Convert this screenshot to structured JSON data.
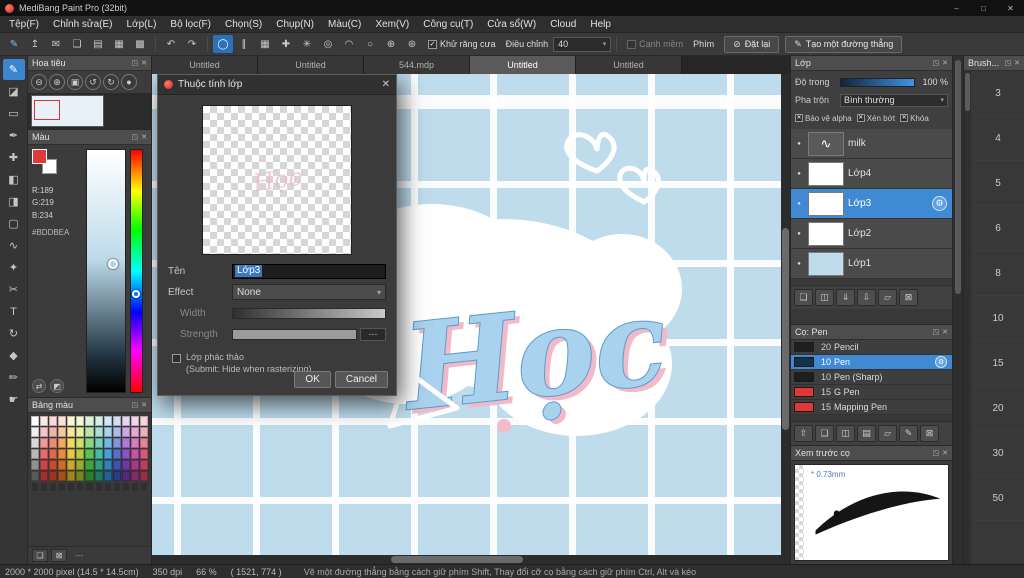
{
  "ui": {
    "float_icon": "◳",
    "close_icon": "✕",
    "dropdown_arrow": "▾",
    "gear_icon": "⚙",
    "eye_icon": "●",
    "check_icon": "✓",
    "x_mark": "✕",
    "stroke_glyph": "∿"
  },
  "colors": {
    "accent_blue": "#3c86d1",
    "selection_blue": "#3f8ad2",
    "canvas_background": "#bedcec",
    "panel_dark": "#3c3c3c"
  },
  "titlebar": {
    "title": "MediBang Paint Pro (32bit)",
    "minimize_icon": "–",
    "maximize_icon": "□",
    "close_icon": "✕"
  },
  "menubar": {
    "items": [
      "Tệp(F)",
      "Chỉnh sửa(E)",
      "Lớp(L)",
      "Bộ lọc(F)",
      "Chọn(S)",
      "Chụp(N)",
      "Màu(C)",
      "Xem(V)",
      "Công cụ(T)",
      "Cửa sổ(W)",
      "Cloud",
      "Help"
    ]
  },
  "toolbar": {
    "file_icons": [
      {
        "name": "brush-edit-icon",
        "glyph": "✎",
        "accent": true
      },
      {
        "name": "publish-icon",
        "glyph": "↥"
      },
      {
        "name": "message-icon",
        "glyph": "✉"
      },
      {
        "name": "export-icon",
        "glyph": "❏"
      },
      {
        "name": "save-icon",
        "glyph": "▤"
      },
      {
        "name": "grid-small-icon",
        "glyph": "▦"
      },
      {
        "name": "grid-large-icon",
        "glyph": "▩"
      }
    ],
    "history_icons": [
      {
        "name": "undo-icon",
        "glyph": "↶"
      },
      {
        "name": "redo-icon",
        "glyph": "↷"
      }
    ],
    "snap_icons": [
      {
        "name": "snap-off-icon",
        "glyph": "◯",
        "selected": true
      },
      {
        "name": "snap-parallel-icon",
        "glyph": "∥"
      },
      {
        "name": "snap-grid-icon",
        "glyph": "▦"
      },
      {
        "name": "snap-cross-icon",
        "glyph": "✚"
      },
      {
        "name": "snap-radial-icon",
        "glyph": "✳"
      },
      {
        "name": "snap-concentric-icon",
        "glyph": "◎"
      },
      {
        "name": "snap-curve-icon",
        "glyph": "◠"
      },
      {
        "name": "snap-ellipse-icon",
        "glyph": "○"
      },
      {
        "name": "snap-add-icon",
        "glyph": "⊕"
      },
      {
        "name": "snap-settings-icon",
        "glyph": "⊛"
      }
    ],
    "antialias_label": "Khử răng cưa",
    "adjust_label": "Điều chỉnh",
    "adjust_value": "40",
    "soft_edge_label": "Cạnh mềm",
    "key_label": "Phím",
    "reset_icon": "⊘",
    "reset_button": "Đặt lại",
    "line_icon": "✎",
    "line_button": "Tạo một đường thẳng"
  },
  "tools": [
    {
      "name": "brush-tool",
      "glyph": "✎",
      "selected": true
    },
    {
      "name": "eraser-tool",
      "glyph": "◪"
    },
    {
      "name": "shape-brush-tool",
      "glyph": "▭"
    },
    {
      "name": "dot-pen-tool",
      "glyph": "✒"
    },
    {
      "name": "move-tool",
      "glyph": "✚"
    },
    {
      "name": "fill-tool",
      "glyph": "◧"
    },
    {
      "name": "gradient-tool",
      "glyph": "◨"
    },
    {
      "name": "select-tool",
      "glyph": "▢"
    },
    {
      "name": "lasso-tool",
      "glyph": "∿"
    },
    {
      "name": "magic-wand-tool",
      "glyph": "✦"
    },
    {
      "name": "select-pen-tool",
      "glyph": "✂"
    },
    {
      "name": "text-tool",
      "glyph": "T"
    },
    {
      "name": "rotate-tool",
      "glyph": "↻"
    },
    {
      "name": "eyedropper-tool",
      "glyph": "◆"
    },
    {
      "name": "pencil-tool",
      "glyph": "✏"
    },
    {
      "name": "hand-tool",
      "glyph": "☛"
    }
  ],
  "left": {
    "navigator": {
      "title": "Hoa tiêu",
      "buttons": [
        {
          "name": "zoom-out-icon",
          "glyph": "⊖"
        },
        {
          "name": "zoom-in-icon",
          "glyph": "⊕"
        },
        {
          "name": "fit-view-icon",
          "glyph": "▣"
        },
        {
          "name": "rotate-left-icon",
          "glyph": "↺"
        },
        {
          "name": "rotate-right-icon",
          "glyph": "↻"
        },
        {
          "name": "reset-view-icon",
          "glyph": "●"
        }
      ]
    },
    "color": {
      "title": "Màu",
      "r": "R:189",
      "g": "G:219",
      "b": "B:234",
      "hex": "#BDDBEA",
      "foreground": "#e03a3a",
      "background_swatch": "#ffffff",
      "icons": [
        {
          "name": "swap-colors-icon",
          "glyph": "⇄"
        },
        {
          "name": "add-to-palette-icon",
          "glyph": "◩"
        }
      ]
    },
    "palette": {
      "title": "Bảng màu",
      "add_icon": "❏",
      "delete_icon": "⊠",
      "footer_value": "---",
      "colors": [
        [
          "#ffffff",
          "#fce9e9",
          "#fbd9d9",
          "#fbe4d4",
          "#fdf3d7",
          "#f4f7d4",
          "#ddf2d6",
          "#d2f0e8",
          "#d2e8f6",
          "#d6dcf4",
          "#e6d6f2",
          "#f4d6ea",
          "#f6d6da"
        ],
        [
          "#f0f0f0",
          "#f6c6c6",
          "#f3b3ac",
          "#f6ca9e",
          "#f8e79d",
          "#e6efa3",
          "#bce6b0",
          "#a9e0d2",
          "#a8d4ee",
          "#aebae8",
          "#cbaae4",
          "#e8aad4",
          "#eeb0bb"
        ],
        [
          "#d8d8d8",
          "#ee9a9a",
          "#ec8a77",
          "#f0a969",
          "#f4d867",
          "#cfe070",
          "#8cd584",
          "#74ceba",
          "#74b9e4",
          "#8393dc",
          "#ac7cd4",
          "#da7cbc",
          "#e4839a"
        ],
        [
          "#b8b8b8",
          "#e36c6c",
          "#e2664a",
          "#e88b3d",
          "#ecc63c",
          "#b4cc44",
          "#5cc258",
          "#44bda0",
          "#4a9ed8",
          "#5a70cc",
          "#8c54c0",
          "#c854a4",
          "#d65a7e"
        ],
        [
          "#909090",
          "#c84848",
          "#c44a30",
          "#ca6e28",
          "#cea828",
          "#94ac30",
          "#3ea43c",
          "#2e9d82",
          "#347fba",
          "#3e52ae",
          "#6e3aa2",
          "#a63a86",
          "#b84062"
        ],
        [
          "#5a5a5a",
          "#9e3232",
          "#9a3620",
          "#a0541c",
          "#a4841c",
          "#748822",
          "#2a8028",
          "#1f7a64",
          "#246294",
          "#2a3a8c",
          "#522a80",
          "#842a68",
          "#92304a"
        ],
        [
          "",
          "",
          "",
          "",
          "",
          "",
          "",
          "",
          "",
          "",
          "",
          "",
          ""
        ]
      ]
    }
  },
  "canvas": {
    "tabs": [
      {
        "label": "Untitled"
      },
      {
        "label": "Untitled"
      },
      {
        "label": "544.mdp"
      },
      {
        "label": "Untitled",
        "selected": true
      },
      {
        "label": "Untitled"
      }
    ],
    "artwork_text": "Học",
    "background_color": "#bedcec"
  },
  "dialog": {
    "title": "Thuộc tính lớp",
    "close_icon": "✕",
    "name_label": "Tên",
    "name_value": "Lớp3",
    "effect_label": "Effect",
    "effect_value": "None",
    "width_label": "Width",
    "strength_label": "Strength",
    "strength_value": "---",
    "draft_line1": "Lớp phác thảo",
    "draft_line2": "(Submit: Hide when rasterizing)",
    "ok_button": "OK",
    "cancel_button": "Cancel"
  },
  "right": {
    "layers": {
      "title": "Lớp",
      "opacity_label": "Độ trong",
      "opacity_value": "100 %",
      "blend_label": "Pha trộn",
      "blend_value": "Bình thường",
      "alpha_label": "Bảo vệ alpha",
      "clip_label": "Xén bớt",
      "lock_label": "Khóa",
      "items": [
        {
          "name": "milk",
          "thumb": "stroke"
        },
        {
          "name": "Lớp4",
          "thumb": "checker"
        },
        {
          "name": "Lớp3",
          "thumb": "checker",
          "selected": true
        },
        {
          "name": "Lớp2",
          "thumb": "checker"
        },
        {
          "name": "Lớp1",
          "thumb": "solid"
        }
      ],
      "actions": [
        {
          "name": "add-layer-icon",
          "glyph": "❏"
        },
        {
          "name": "duplicate-layer-icon",
          "glyph": "◫"
        },
        {
          "name": "merge-down-icon",
          "glyph": "⇓"
        },
        {
          "name": "transfer-layer-icon",
          "glyph": "⇩"
        },
        {
          "name": "add-folder-icon",
          "glyph": "▱"
        },
        {
          "name": "delete-layer-icon",
          "glyph": "⊠"
        }
      ]
    },
    "brushes": {
      "title": "Cọ: Pen",
      "items": [
        {
          "size": "20",
          "name": "Pencil",
          "swatch": "#1f1f1f"
        },
        {
          "size": "10",
          "name": "Pen",
          "swatch": "#16324a",
          "selected": true
        },
        {
          "size": "10",
          "name": "Pen (Sharp)",
          "swatch": "#1f1f1f"
        },
        {
          "size": "15",
          "name": "G Pen",
          "swatch": "#e03838"
        },
        {
          "size": "15",
          "name": "Mapping Pen",
          "swatch": "#e03838"
        }
      ],
      "actions": [
        {
          "name": "upload-brush-icon",
          "glyph": "⇧"
        },
        {
          "name": "add-brush-icon",
          "glyph": "❏"
        },
        {
          "name": "clone-brush-icon",
          "glyph": "◫"
        },
        {
          "name": "brush-menu-icon",
          "glyph": "▤"
        },
        {
          "name": "brush-folder-icon",
          "glyph": "▱"
        },
        {
          "name": "edit-brush-icon",
          "glyph": "✎"
        },
        {
          "name": "delete-brush-icon",
          "glyph": "⊠"
        }
      ]
    },
    "preview": {
      "title": "Xem trước cọ",
      "size_label": "* 0.73mm"
    },
    "sizes": {
      "title": "Brush...",
      "values": [
        "3",
        "4",
        "5",
        "6",
        "8",
        "10",
        "15",
        "20",
        "30",
        "50"
      ]
    }
  },
  "statusbar": {
    "size": "2000 * 2000 pixel  (14.5 * 14.5cm)",
    "dpi": "350 dpi",
    "zoom": "66 %",
    "coords": "( 1521, 774 )",
    "hint": "Vẽ một đường thẳng bằng cách giữ phím Shift, Thay đổi cỡ cọ bằng cách giữ phím Ctrl, Alt và kéo"
  }
}
